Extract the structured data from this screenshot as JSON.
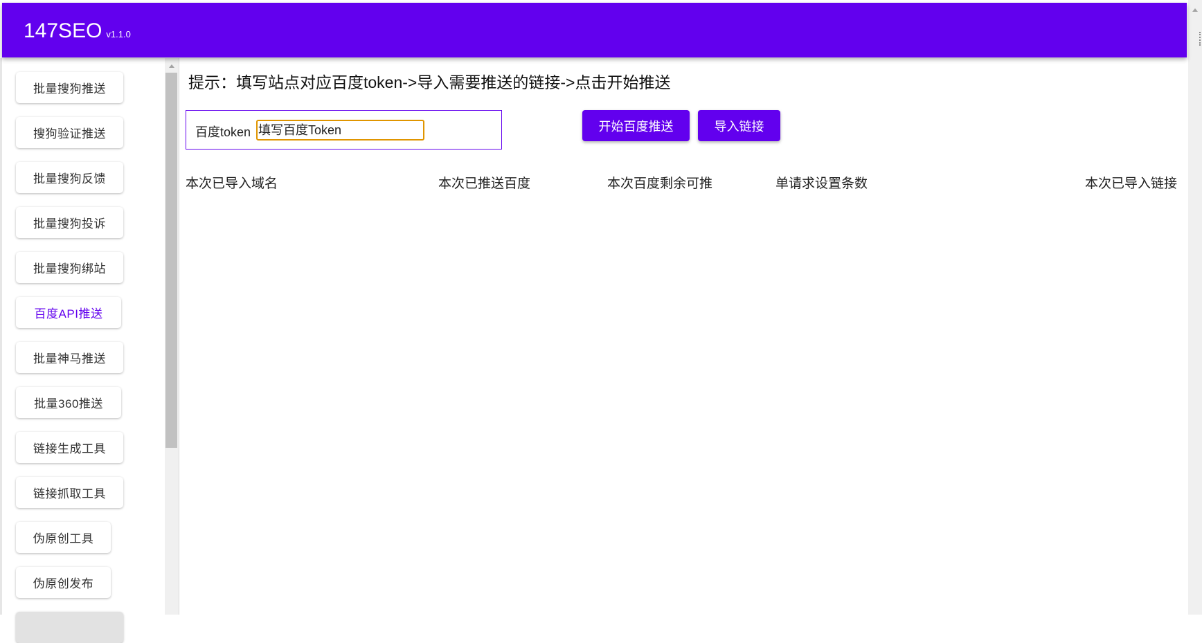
{
  "app": {
    "name": "147SEO",
    "version": "v1.1.0",
    "accent": "#6200ee"
  },
  "sidebar": {
    "items": [
      {
        "label": "批量搜狗推送"
      },
      {
        "label": "搜狗验证推送"
      },
      {
        "label": "批量搜狗反馈"
      },
      {
        "label": "批量搜狗投诉"
      },
      {
        "label": "批量搜狗绑站"
      },
      {
        "label": "百度API推送",
        "active": true
      },
      {
        "label": "批量神马推送"
      },
      {
        "label": "批量360推送"
      },
      {
        "label": "链接生成工具"
      },
      {
        "label": "链接抓取工具"
      },
      {
        "label": "伪原创工具"
      },
      {
        "label": "伪原创发布"
      }
    ]
  },
  "main": {
    "hint": "提示：填写站点对应百度token->导入需要推送的链接->点击开始推送",
    "token_label": "百度token",
    "token_value": "",
    "token_placeholder": "填写百度Token",
    "start_button": "开始百度推送",
    "import_button": "导入链接",
    "stats": {
      "imported_domains": "本次已导入域名",
      "pushed_baidu": "本次已推送百度",
      "remaining_baidu": "本次百度剩余可推",
      "per_request": "单请求设置条数",
      "imported_links": "本次已导入链接"
    }
  }
}
